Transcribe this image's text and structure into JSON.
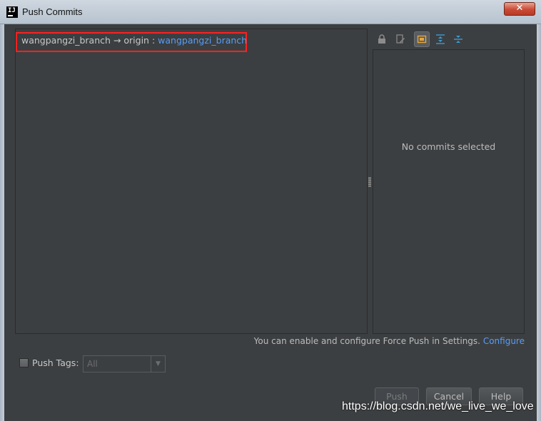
{
  "window": {
    "title": "Push Commits",
    "app_icon": "IJ",
    "close_glyph": "✕"
  },
  "tree": {
    "local_branch": "wangpangzi_branch",
    "arrow": "→",
    "remote": "origin",
    "separator": ":",
    "remote_branch": "wangpangzi_branch",
    "remote_branch_color": "#589df6",
    "highlight_color": "#ff2020"
  },
  "toolbar": {
    "icons": [
      "lock-icon",
      "edit-source-icon",
      "preview-details-icon",
      "expand-all-icon",
      "collapse-all-icon"
    ]
  },
  "details": {
    "empty_text": "No commits selected"
  },
  "footer": {
    "force_push_text": "You can enable and configure Force Push in Settings.",
    "configure_link": "Configure",
    "push_tags_label": "Push Tags:",
    "push_tags_checked": false,
    "tags_select_value": "All"
  },
  "buttons": {
    "push": "Push",
    "cancel": "Cancel",
    "help": "Help"
  },
  "watermark": "https://blog.csdn.net/we_live_we_love"
}
